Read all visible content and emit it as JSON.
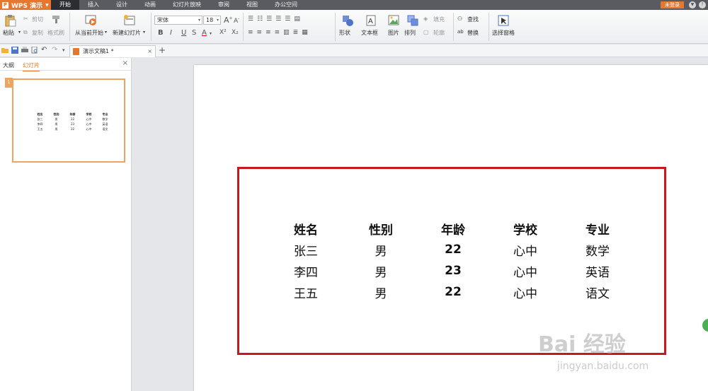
{
  "app": {
    "name": "WPS 演示",
    "menu_tabs": [
      "开始",
      "插入",
      "设计",
      "动画",
      "幻灯片放映",
      "审阅",
      "视图",
      "办公空间"
    ],
    "login_label": "未登录"
  },
  "ribbon": {
    "paste": "粘贴",
    "cut": "剪切",
    "copy": "复制",
    "format_painter": "格式刷",
    "from_current": "从当前开始",
    "new_slide": "新建幻灯片",
    "font_name": "宋体",
    "font_size": "18",
    "shape": "形状",
    "textbox": "文本框",
    "picture": "图片",
    "arrange": "排列",
    "fill": "填充",
    "outline": "轮廓",
    "find": "查找",
    "replace": "替换",
    "selection_pane": "选择窗格"
  },
  "tabs": {
    "doc_title": "演示文稿1 *"
  },
  "left_pane": {
    "tab_outline": "大纲",
    "tab_slides": "幻灯片",
    "slide_number": "1"
  },
  "slide_table": {
    "headers": [
      "姓名",
      "性别",
      "年龄",
      "学校",
      "专业"
    ],
    "rows": [
      [
        "张三",
        "男",
        "22",
        "心中",
        "数学"
      ],
      [
        "李四",
        "男",
        "23",
        "心中",
        "英语"
      ],
      [
        "王五",
        "男",
        "22",
        "心中",
        "语文"
      ]
    ]
  },
  "colors": {
    "accent": "#e8772e",
    "highlight_border": "#c8171d",
    "menubar": "#595b60"
  }
}
